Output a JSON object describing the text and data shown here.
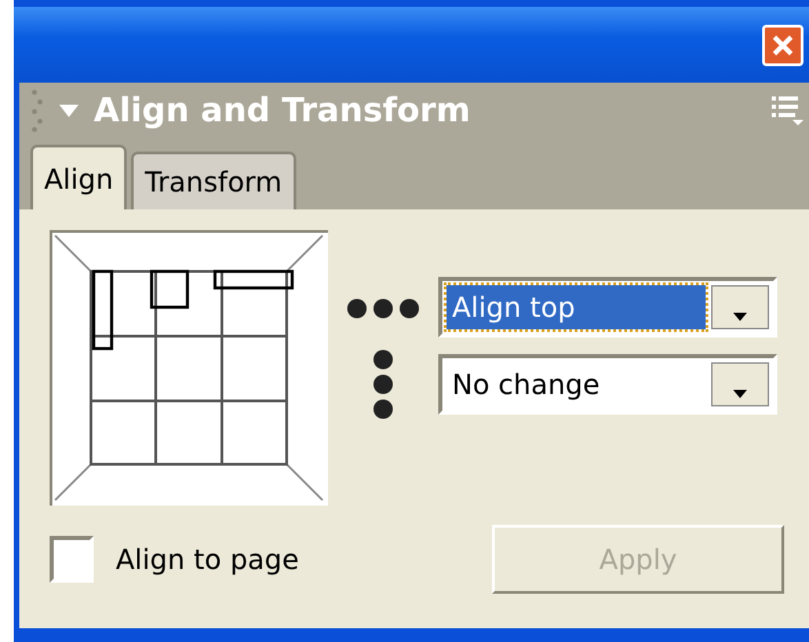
{
  "panel": {
    "title": "Align and Transform",
    "expanded": true
  },
  "tabs": [
    {
      "label": "Align",
      "selected": true
    },
    {
      "label": "Transform",
      "selected": false
    }
  ],
  "dropdowns": [
    {
      "kind": "horizontal",
      "value": "Align top",
      "focused": true
    },
    {
      "kind": "vertical",
      "value": "No change",
      "focused": false
    }
  ],
  "align_to_page": {
    "label": "Align to page",
    "checked": false
  },
  "apply_button": {
    "label": "Apply",
    "disabled": true
  }
}
